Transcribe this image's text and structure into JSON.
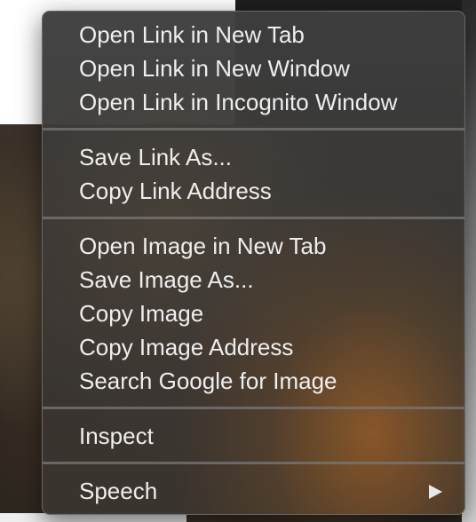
{
  "context_menu": {
    "groups": [
      {
        "items": [
          {
            "label": "Open Link in New Tab"
          },
          {
            "label": "Open Link in New Window"
          },
          {
            "label": "Open Link in Incognito Window"
          }
        ]
      },
      {
        "items": [
          {
            "label": "Save Link As..."
          },
          {
            "label": "Copy Link Address"
          }
        ]
      },
      {
        "items": [
          {
            "label": "Open Image in New Tab"
          },
          {
            "label": "Save Image As..."
          },
          {
            "label": "Copy Image"
          },
          {
            "label": "Copy Image Address"
          },
          {
            "label": "Search Google for Image"
          }
        ]
      },
      {
        "items": [
          {
            "label": "Inspect"
          }
        ]
      },
      {
        "items": [
          {
            "label": "Speech",
            "submenu_icon": "chevron-right-icon"
          }
        ]
      }
    ]
  },
  "colors": {
    "menu_text": "#eeeeee",
    "separator": "#787878",
    "menu_border": "#8c8c8c"
  }
}
